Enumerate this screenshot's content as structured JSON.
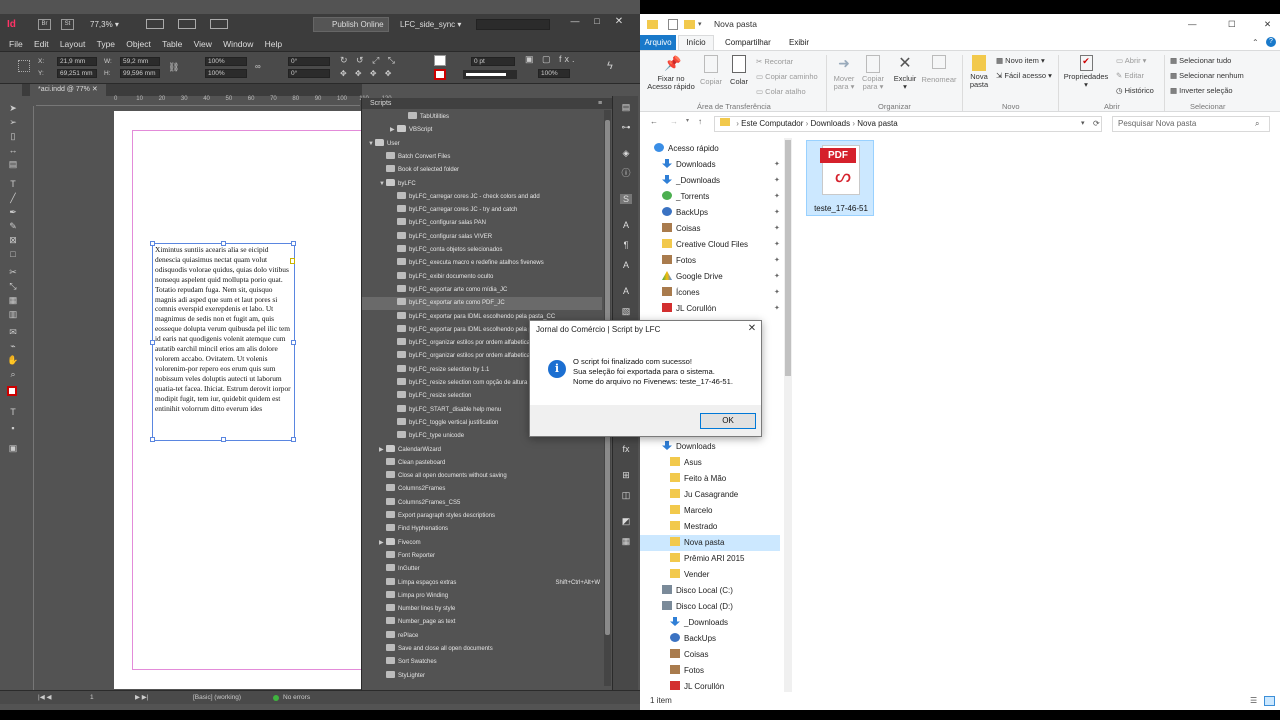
{
  "indesign": {
    "app_icon": "Id",
    "top_bar": {
      "zoom": "77,3%",
      "publish_label": "Publish Online",
      "workspace": "LFC_side_sync"
    },
    "menu": [
      "File",
      "Edit",
      "Layout",
      "Type",
      "Object",
      "Table",
      "View",
      "Window",
      "Help"
    ],
    "control": {
      "x": "21,9 mm",
      "y": "69,251 mm",
      "w": "59,2 mm",
      "h": "99,596 mm",
      "scale_x": "100%",
      "scale_y": "100%",
      "rotate": "0°",
      "shear": "0°",
      "stroke_weight": "0 pt",
      "opacity": "100%"
    },
    "doc_tab": "*aci.indd @ 77%",
    "ruler_ticks": [
      "0",
      "10",
      "20",
      "30",
      "40",
      "50",
      "60",
      "70",
      "80",
      "90",
      "100",
      "110",
      "120"
    ],
    "text": "Ximintus suntiis acearis alia se eicipid denescia quiasimus nectat quam volut odisquodis volorae quidus, quias dolo vitibus nonsequ aspelent quid mollupta porio quat. Totatio repudam fuga. Nem sit, quisquo magnis adi asped que sum et laut pores si comnis everspid exerepdenis et labo. Ut magnimus de sedis non et fugit am, quis eosseque dolupta verum quibusda pel ilic tem id earis nat quodigenis volenit atemque cum autatib earchil mincil erios am alis dolore volorem accabo. Ovitatem. Ut volenis volorenim-por repero eos erum quis sum nobissum veles doluptis autecti ut laborum quatia-tet facea. Ihiciat. Estrum derovit iorpor modipit fugit, tem iur, quidebit quidem est entinihit volorrum ditto everum ides",
    "status": {
      "page": "1",
      "style": "[Basic] (working)",
      "errors": "No errors"
    }
  },
  "scripts_panel": {
    "title": "Scripts",
    "rows": [
      {
        "label": "TabUtilities",
        "kind": "script",
        "indent": 3
      },
      {
        "label": "VBScript",
        "kind": "folder",
        "indent": 2,
        "arrow": "▶"
      },
      {
        "label": "User",
        "kind": "folder",
        "indent": 0,
        "arrow": "▼"
      },
      {
        "label": "Batch Convert Files",
        "kind": "script",
        "indent": 1
      },
      {
        "label": "Book of selected folder",
        "kind": "script",
        "indent": 1
      },
      {
        "label": "byLFC",
        "kind": "folder",
        "indent": 1,
        "arrow": "▼"
      },
      {
        "label": "byLFC_carregar cores JC - check colors and add",
        "kind": "script",
        "indent": 2
      },
      {
        "label": "byLFC_carregar cores JC - try and catch",
        "kind": "script",
        "indent": 2
      },
      {
        "label": "byLFC_configurar salas PAN",
        "kind": "script",
        "indent": 2
      },
      {
        "label": "byLFC_configurar salas VIVER",
        "kind": "script",
        "indent": 2
      },
      {
        "label": "byLFC_conta objetos selecionados",
        "kind": "script",
        "indent": 2
      },
      {
        "label": "byLFC_executa macro e redefine atalhos fivenews",
        "kind": "script",
        "indent": 2
      },
      {
        "label": "byLFC_exibir documento oculto",
        "kind": "script",
        "indent": 2
      },
      {
        "label": "byLFC_exportar arte como mídia_JC",
        "kind": "script",
        "indent": 2
      },
      {
        "label": "byLFC_exportar arte como PDF_JC",
        "kind": "script",
        "indent": 2,
        "selected": true
      },
      {
        "label": "byLFC_exportar para IDML escolhendo pela pasta_CC",
        "kind": "script",
        "indent": 2
      },
      {
        "label": "byLFC_exportar para IDML escolhendo pela pa",
        "kind": "script",
        "indent": 2
      },
      {
        "label": "byLFC_organizar estilos por ordem alfabetica",
        "kind": "script",
        "indent": 2
      },
      {
        "label": "byLFC_organizar estilos por ordem alfabetica",
        "kind": "script",
        "indent": 2
      },
      {
        "label": "byLFC_resize selection by 1.1",
        "kind": "script",
        "indent": 2
      },
      {
        "label": "byLFC_resize selection com opção de altura e",
        "kind": "script",
        "indent": 2
      },
      {
        "label": "byLFC_resize selection",
        "kind": "script",
        "indent": 2
      },
      {
        "label": "byLFC_START_disable help menu",
        "kind": "script",
        "indent": 2
      },
      {
        "label": "byLFC_toggle vertical justification",
        "kind": "script",
        "indent": 2
      },
      {
        "label": "byLFC_type unicode",
        "kind": "script",
        "indent": 2
      },
      {
        "label": "CalendarWizard",
        "kind": "folder",
        "indent": 1,
        "arrow": "▶"
      },
      {
        "label": "Clean pasteboard",
        "kind": "script",
        "indent": 1
      },
      {
        "label": "Close all open documents without saving",
        "kind": "script",
        "indent": 1
      },
      {
        "label": "Columns2Frames",
        "kind": "script",
        "indent": 1
      },
      {
        "label": "Columns2Frames_CS5",
        "kind": "script",
        "indent": 1
      },
      {
        "label": "Export paragraph styles descriptions",
        "kind": "script",
        "indent": 1
      },
      {
        "label": "Find Hyphenations",
        "kind": "script",
        "indent": 1
      },
      {
        "label": "Fivecom",
        "kind": "folder",
        "indent": 1,
        "arrow": "▶"
      },
      {
        "label": "Font Reporter",
        "kind": "script",
        "indent": 1
      },
      {
        "label": "InGutter",
        "kind": "script",
        "indent": 1
      },
      {
        "label": "Limpa espaços extras",
        "kind": "script",
        "indent": 1,
        "shortcut": "Shift+Ctrl+Alt+W"
      },
      {
        "label": "Limpa pro Winding",
        "kind": "script",
        "indent": 1
      },
      {
        "label": "Number lines by style",
        "kind": "script",
        "indent": 1
      },
      {
        "label": "Number_page as text",
        "kind": "script",
        "indent": 1
      },
      {
        "label": "rePlace",
        "kind": "script",
        "indent": 1
      },
      {
        "label": "Save and close all open documents",
        "kind": "script",
        "indent": 1
      },
      {
        "label": "Sort Swatches",
        "kind": "script",
        "indent": 1
      },
      {
        "label": "StyLighter",
        "kind": "script",
        "indent": 1
      }
    ]
  },
  "dialog": {
    "title": "Jornal do Comércio | Script by LFC",
    "lines": [
      "O script foi finalizado com sucesso!",
      "Sua seleção foi exportada para o sistema.",
      "Nome do arquivo no Fivenews: teste_17-46-51."
    ],
    "ok_label": "OK"
  },
  "explorer": {
    "title": "Nova pasta",
    "tabs": [
      "Arquivo",
      "Início",
      "Compartilhar",
      "Exibir"
    ],
    "ribbon": {
      "pin": "Fixar no\nAcesso rápido",
      "copy": "Copiar",
      "paste": "Colar",
      "cut": "Recortar",
      "copy_path": "Copiar caminho",
      "paste_shortcut": "Colar atalho",
      "clipboard_group": "Área de Transferência",
      "move_to": "Mover\npara ▾",
      "copy_to": "Copiar\npara ▾",
      "delete": "Excluir\n▾",
      "rename": "Renomear",
      "organize_group": "Organizar",
      "new_folder": "Nova\npasta",
      "new_item": "Novo item ▾",
      "easy_access": "Fácil acesso ▾",
      "new_group": "Novo",
      "properties": "Propriedades\n▾",
      "open": "Abrir ▾",
      "edit": "Editar",
      "history": "Histórico",
      "open_group": "Abrir",
      "select_all": "Selecionar tudo",
      "select_none": "Selecionar nenhum",
      "invert": "Inverter seleção",
      "select_group": "Selecionar"
    },
    "breadcrumb": [
      "Este Computador",
      "Downloads",
      "Nova pasta"
    ],
    "search_placeholder": "Pesquisar Nova pasta",
    "nav": [
      {
        "label": "Acesso rápido",
        "icon": "star",
        "indent": 0
      },
      {
        "label": "Downloads",
        "icon": "download",
        "indent": 1,
        "pinned": true
      },
      {
        "label": "_Downloads",
        "icon": "download",
        "indent": 1,
        "pinned": true
      },
      {
        "label": "_Torrents",
        "icon": "torrent",
        "indent": 1,
        "pinned": true
      },
      {
        "label": "BackUps",
        "icon": "drive",
        "indent": 1,
        "pinned": true
      },
      {
        "label": "Coisas",
        "icon": "box",
        "indent": 1,
        "pinned": true
      },
      {
        "label": "Creative Cloud Files",
        "icon": "folder",
        "indent": 1,
        "pinned": true
      },
      {
        "label": "Fotos",
        "icon": "box",
        "indent": 1,
        "pinned": true
      },
      {
        "label": "Google Drive",
        "icon": "gdrive",
        "indent": 1,
        "pinned": true
      },
      {
        "label": "Ícones",
        "icon": "box",
        "indent": 1,
        "pinned": true
      },
      {
        "label": "JL Corullón",
        "icon": "red",
        "indent": 1,
        "pinned": true
      }
    ],
    "nav2": [
      {
        "label": "Downloads",
        "icon": "download",
        "indent": 1
      },
      {
        "label": "Asus",
        "icon": "folder",
        "indent": 2
      },
      {
        "label": "Feito à Mão",
        "icon": "folder",
        "indent": 2
      },
      {
        "label": "Ju Casagrande",
        "icon": "folder",
        "indent": 2
      },
      {
        "label": "Marcelo",
        "icon": "folder",
        "indent": 2
      },
      {
        "label": "Mestrado",
        "icon": "folder",
        "indent": 2
      },
      {
        "label": "Nova pasta",
        "icon": "folder",
        "indent": 2,
        "selected": true
      },
      {
        "label": "Prêmio ARI 2015",
        "icon": "folder",
        "indent": 2
      },
      {
        "label": "Vender",
        "icon": "folder",
        "indent": 2
      },
      {
        "label": "Disco Local (C:)",
        "icon": "disk",
        "indent": 1
      },
      {
        "label": "Disco Local (D:)",
        "icon": "disk",
        "indent": 1
      },
      {
        "label": "_Downloads",
        "icon": "download",
        "indent": 2
      },
      {
        "label": "BackUps",
        "icon": "drive",
        "indent": 2
      },
      {
        "label": "Coisas",
        "icon": "box",
        "indent": 2
      },
      {
        "label": "Fotos",
        "icon": "box",
        "indent": 2
      },
      {
        "label": "JL Corullón",
        "icon": "red",
        "indent": 2
      }
    ],
    "file": {
      "name": "teste_17-46-51",
      "badge": "PDF"
    },
    "status": "1 item"
  },
  "colors": {
    "accent": "#0078d7",
    "pdf_red": "#d5202b",
    "selection": "#cce8ff",
    "margin": "#e38bd9"
  }
}
